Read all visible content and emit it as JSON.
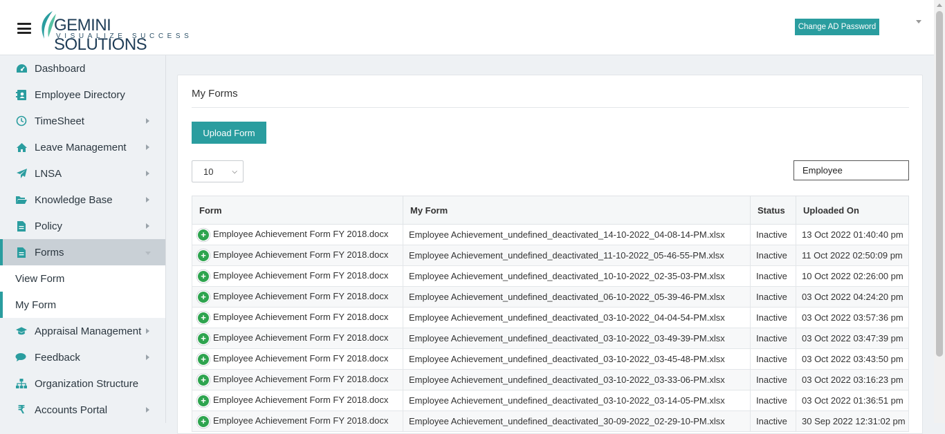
{
  "header": {
    "logo_name": "GEMINI SOLUTIONS",
    "logo_tagline": "VISUALIZE SUCCESS",
    "ad_password_label": "Change AD Password"
  },
  "sidebar": {
    "items": [
      {
        "label": "Dashboard",
        "icon": "dashboard-icon"
      },
      {
        "label": "Employee Directory",
        "icon": "directory-icon"
      },
      {
        "label": "TimeSheet",
        "icon": "clock-icon"
      },
      {
        "label": "Leave Management",
        "icon": "home-icon"
      },
      {
        "label": "LNSA",
        "icon": "paper-plane-icon"
      },
      {
        "label": "Knowledge Base",
        "icon": "folder-icon"
      },
      {
        "label": "Policy",
        "icon": "document-icon"
      },
      {
        "label": "Forms",
        "icon": "form-icon"
      },
      {
        "label": "Appraisal Management",
        "icon": "graduation-cap-icon"
      },
      {
        "label": "Feedback",
        "icon": "comments-icon"
      },
      {
        "label": "Organization Structure",
        "icon": "sitemap-icon"
      },
      {
        "label": "Accounts Portal",
        "icon": "rupee-icon"
      }
    ],
    "forms_sub": {
      "view_form": "View Form",
      "my_form": "My Form"
    }
  },
  "main": {
    "title": "My Forms",
    "upload_label": "Upload Form",
    "page_size": "10",
    "search_value": "Employee",
    "columns": [
      "Form",
      "My Form",
      "Status",
      "Uploaded On"
    ],
    "rows": [
      {
        "form": "Employee Achievement Form FY 2018.docx",
        "my_form": "Employee Achievement_undefined_deactivated_14-10-2022_04-08-14-PM.xlsx",
        "status": "Inactive",
        "uploaded": "13 Oct 2022 01:40:40 pm"
      },
      {
        "form": "Employee Achievement Form FY 2018.docx",
        "my_form": "Employee Achievement_undefined_deactivated_11-10-2022_05-46-55-PM.xlsx",
        "status": "Inactive",
        "uploaded": "11 Oct 2022 02:50:09 pm"
      },
      {
        "form": "Employee Achievement Form FY 2018.docx",
        "my_form": "Employee Achievement_undefined_deactivated_10-10-2022_02-35-03-PM.xlsx",
        "status": "Inactive",
        "uploaded": "10 Oct 2022 02:26:00 pm"
      },
      {
        "form": "Employee Achievement Form FY 2018.docx",
        "my_form": "Employee Achievement_undefined_deactivated_06-10-2022_05-39-46-PM.xlsx",
        "status": "Inactive",
        "uploaded": "03 Oct 2022 04:24:20 pm"
      },
      {
        "form": "Employee Achievement Form FY 2018.docx",
        "my_form": "Employee Achievement_undefined_deactivated_03-10-2022_04-04-54-PM.xlsx",
        "status": "Inactive",
        "uploaded": "03 Oct 2022 03:57:36 pm"
      },
      {
        "form": "Employee Achievement Form FY 2018.docx",
        "my_form": "Employee Achievement_undefined_deactivated_03-10-2022_03-49-39-PM.xlsx",
        "status": "Inactive",
        "uploaded": "03 Oct 2022 03:47:39 pm"
      },
      {
        "form": "Employee Achievement Form FY 2018.docx",
        "my_form": "Employee Achievement_undefined_deactivated_03-10-2022_03-45-48-PM.xlsx",
        "status": "Inactive",
        "uploaded": "03 Oct 2022 03:43:50 pm"
      },
      {
        "form": "Employee Achievement Form FY 2018.docx",
        "my_form": "Employee Achievement_undefined_deactivated_03-10-2022_03-33-06-PM.xlsx",
        "status": "Inactive",
        "uploaded": "03 Oct 2022 03:16:23 pm"
      },
      {
        "form": "Employee Achievement Form FY 2018.docx",
        "my_form": "Employee Achievement_undefined_deactivated_03-10-2022_03-14-05-PM.xlsx",
        "status": "Inactive",
        "uploaded": "03 Oct 2022 01:36:51 pm"
      },
      {
        "form": "Employee Achievement Form FY 2018.docx",
        "my_form": "Employee Achievement_undefined_deactivated_30-09-2022_02-29-10-PM.xlsx",
        "status": "Inactive",
        "uploaded": "30 Sep 2022 12:31:02 pm"
      }
    ]
  },
  "colors": {
    "accent": "#2a9d9f",
    "add_icon": "#2ea44f"
  }
}
